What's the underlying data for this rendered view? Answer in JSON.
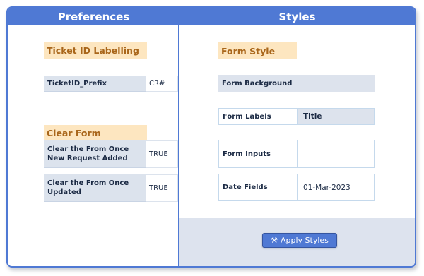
{
  "preferences": {
    "header": "Preferences",
    "ticket_section_title": "Ticket ID Labelling",
    "ticket_prefix_label": "TicketID_Prefix",
    "ticket_prefix_value": "CR#",
    "clear_section_title": "Clear Form",
    "clear_new_label": "Clear the From Once New Request Added",
    "clear_new_value": "TRUE",
    "clear_updated_label": "Clear the From Once Updated",
    "clear_updated_value": "TRUE"
  },
  "styles": {
    "header": "Styles",
    "section_title": "Form Style",
    "form_background_label": "Form Background",
    "form_background_value": "",
    "form_labels_label": "Form Labels",
    "form_labels_value": "Title",
    "form_inputs_label": "Form Inputs",
    "form_inputs_value": "",
    "date_fields_label": "Date Fields",
    "date_fields_value": "01-Mar-2023",
    "apply_button": "Apply Styles",
    "apply_icon": "tools-icon"
  },
  "colors": {
    "accent": "#4f79d4",
    "section_bg": "#fde6c0",
    "section_text": "#a9661a",
    "label_bg": "#dce3ed"
  }
}
